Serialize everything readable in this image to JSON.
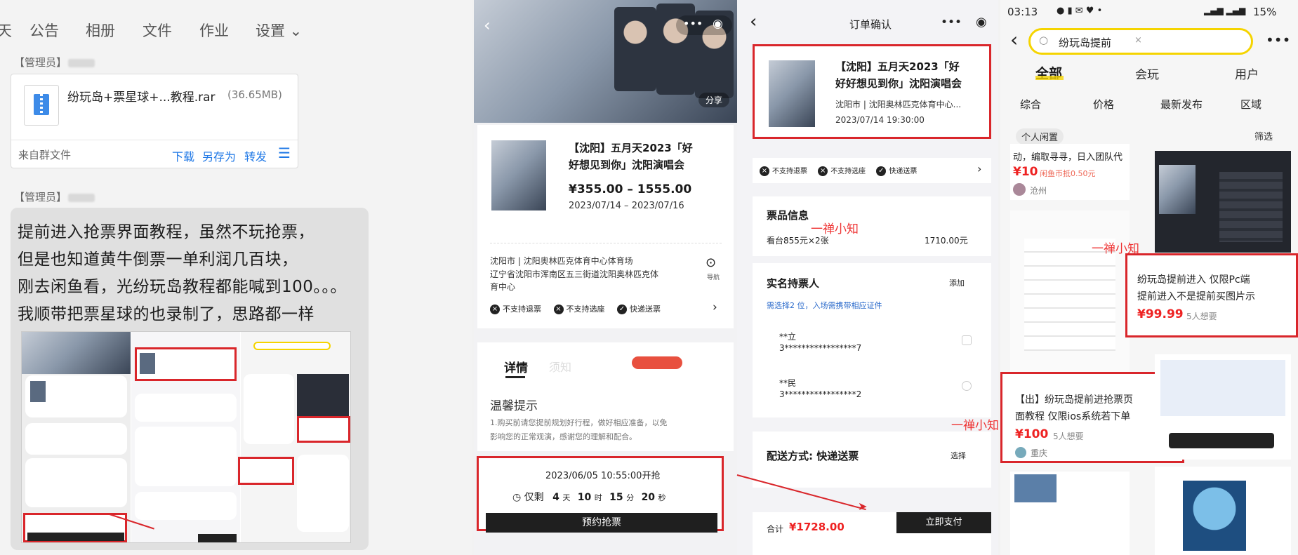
{
  "chat": {
    "tabs": [
      "天",
      "公告",
      "相册",
      "文件",
      "作业",
      "设置 ⌄"
    ],
    "admin_label_1": "【管理员】",
    "admin_label_2": "【管理员】",
    "file": {
      "name": "纷玩岛+票星球+...教程.rar",
      "size": "(36.65MB)",
      "source": "来自群文件",
      "download": "下载",
      "save_as": "另存为",
      "forward": "转发"
    },
    "message_lines": [
      "提前进入抢票界面教程，虽然不玩抢票，",
      "但是也知道黄牛倒票一单利润几百块，",
      "刚去闲鱼看，光纷玩岛教程都能喊到100。。。",
      "我顺带把票星球的也录制了，思路都一样"
    ]
  },
  "p1": {
    "share": "分享",
    "event_title_1": "【沈阳】五月天2023「好",
    "event_title_2": "好想见到你」沈阳演唱会",
    "price": "¥355.00 – 1555.00",
    "dates": "2023/07/14 – 2023/07/16",
    "venue_1": "沈阳市 | 沈阳奥林匹克体育中心体育场",
    "venue_2": "辽宁省沈阳市浑南区五三街道沈阳奥林匹克体",
    "venue_3": "育中心",
    "nav_label": "导航",
    "policies": [
      "不支持退票",
      "不支持选座",
      "快递送票"
    ],
    "tab_detail": "详情",
    "tab_notice": "须知",
    "tip_title": "温馨提示",
    "tip_1": "1.购买前请您提前规划好行程，做好相应准备，以免",
    "tip_2": "影响您的正常观演，感谢您的理解和配合。",
    "start_time": "2023/06/05 10:55:00开抢",
    "countdown": [
      "仅剩",
      "4",
      "天",
      "10",
      "时",
      "15",
      "分",
      "20",
      "秒"
    ],
    "buy_button": "预约抢票"
  },
  "p2": {
    "header": "订单确认",
    "title_1": "【沈阳】五月天2023「好",
    "title_2": "好好想见到你」沈阳演唱会",
    "venue": "沈阳市 | 沈阳奥林匹克体育中心...",
    "datetime": "2023/07/14 19:30:00",
    "policies": [
      "不支持退票",
      "不支持选座",
      "快递送票"
    ],
    "ticket_info": "票品信息",
    "ticket_line": "看台855元×2张",
    "ticket_amount": "1710.00元",
    "holder_title": "实名持票人",
    "holder_add": "添加",
    "holder_hint": "需选择2 位，入场需携带相应证件",
    "holders": [
      {
        "name": "**立",
        "id": "3*****************7"
      },
      {
        "name": "**民",
        "id": "3*****************2"
      }
    ],
    "delivery": "配送方式: 快递送票",
    "delivery_select": "选择",
    "total_label": "合计",
    "total": "¥1728.00",
    "pay_button": "立即支付"
  },
  "p3": {
    "status_time": "03:13",
    "battery": "15%",
    "search_query": "纷玩岛提前",
    "tabs": [
      "全部",
      "会玩",
      "用户"
    ],
    "filters": [
      "综合",
      "价格",
      "最新发布",
      "区域"
    ],
    "personal": "个人闲置",
    "filter_btn": "筛选",
    "item_top_text": "动，编取寻寻，日入团队代",
    "item_top_price": "¥10",
    "item_top_coin": "闲鱼币抵0.50元",
    "item_top_loc": "沧州",
    "item_right_title_1": "纷玩岛提前进入 仅限Pc端",
    "item_right_title_2": "提前进入不是提前买图片示",
    "item_right_price": "¥99.99",
    "item_right_want": "5人想要",
    "item_left_title_1": "【出】纷玩岛提前进抢票页",
    "item_left_title_2": "面教程 仅限ios系统若下单",
    "item_left_price": "¥100",
    "item_left_want": "5人想要",
    "item_left_loc": "重庆"
  },
  "watermark": "一禅小知"
}
